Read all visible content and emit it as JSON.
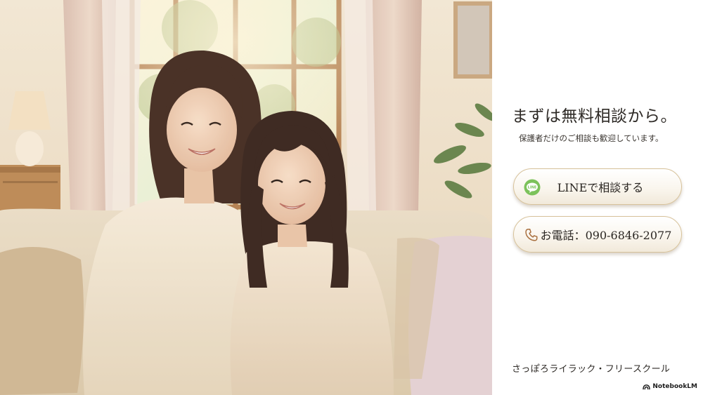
{
  "photo": {
    "description_icon": "mother-and-daughter-photo"
  },
  "panel": {
    "headline": "まずは無料相談から。",
    "subtext": "保護者だけのご相談も歓迎しています。",
    "line_button": {
      "icon": "line-logo-icon",
      "icon_text": "LINE",
      "label": "LINEで相談する"
    },
    "phone_button": {
      "icon": "phone-icon",
      "label": "お電話：090-6846-2077"
    },
    "school_name": "さっぽろライラック・フリースクール",
    "watermark": "NotebookLM"
  },
  "colors": {
    "button_border": "#d7c29a",
    "line_green": "#7cc25b",
    "text_dark": "#2e2a26"
  }
}
